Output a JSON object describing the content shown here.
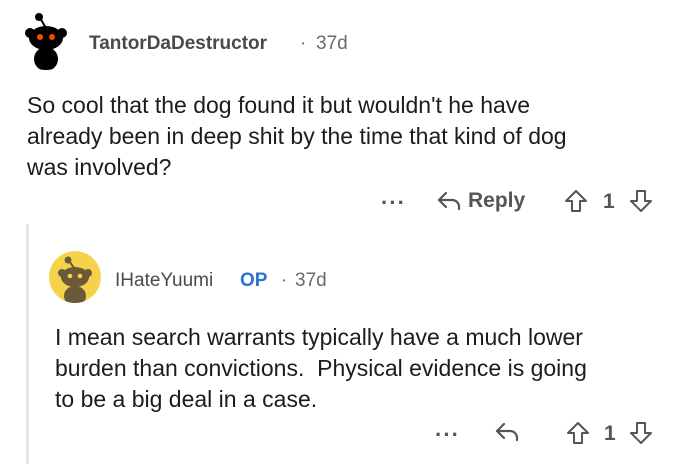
{
  "comment1": {
    "username": "TantorDaDestructor",
    "separator": "·",
    "age": "37d",
    "lines": [
      "So cool that the dog found it but wouldn't he have",
      "already been in deep shit by the time that kind of dog",
      "was involved?"
    ],
    "more_label": "···",
    "reply_label": "Reply",
    "vote_count": "1"
  },
  "comment2": {
    "username": "IHateYuumi",
    "op_badge": "OP",
    "separator": "·",
    "age": "37d",
    "lines": [
      "I mean search warrants typically have a much lower",
      "burden than convictions.  Physical evidence is going",
      "to be a big deal in a case."
    ],
    "more_label": "···",
    "vote_count": "1"
  },
  "colors": {
    "avatar1_bg": "#ffffff",
    "avatar2_bg": "#f6d24a",
    "op_blue": "#2f6fd6"
  },
  "icons": [
    "snoo-avatar-icon",
    "reply-arrow-icon",
    "upvote-icon",
    "downvote-icon"
  ]
}
